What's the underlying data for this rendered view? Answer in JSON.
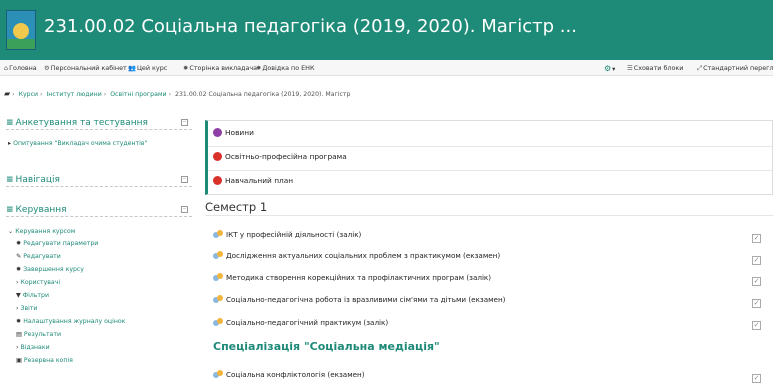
{
  "header": {
    "title": "231.00.02 Соціальна педагогіка (2019, 2020). Магістр ..."
  },
  "navbar": {
    "home": "Головна",
    "cabinet": "Персональний кабінет",
    "course": "Цей курс",
    "teacher_page": "Сторінка викладача",
    "help": "Довідка по ЕНК",
    "hide_blocks": "Сховати блоки",
    "standard_view": "Стандартний перегляд"
  },
  "breadcrumb": {
    "items": [
      "Курси",
      "Інститут людини",
      "Освітні програми"
    ],
    "current": "231.00.02 Соціальна педагогіка (2019, 2020). Магістр"
  },
  "sidebar": {
    "survey": {
      "title": "Анкетування та тестування",
      "link": "Опитування \"Викладач очима студентів\""
    },
    "navigation": {
      "title": "Навігація"
    },
    "management": {
      "title": "Керування",
      "course_admin": "Керування курсом",
      "items": [
        "Редагувати параметри",
        "Редагувати",
        "Завершення курсу",
        "Користувачі",
        "Фільтри",
        "Звіти",
        "Налаштування журналу оцінок",
        "Результати",
        "Відзнаки",
        "Резервна копія"
      ]
    }
  },
  "top_section": {
    "items": [
      "Новини",
      "Освітньо-професійна програма",
      "Навчальний план"
    ]
  },
  "semester": {
    "title": "Семестр 1",
    "activities": [
      "ІКТ у професійній діяльності (залік)",
      "Дослідження актуальних соціальних проблем з практикумом (екзамен)",
      "Методика створення корекційних та профілактичних програм (залік)",
      "Соціально-педагогічна робота із вразливими сім'ями та дітьми (екзамен)",
      "Соціально-педагогічний практикум (залік)"
    ],
    "specialization": "Спеціалізація \"Соціальна медіація\"",
    "spec_activities": [
      "Соціальна конфліктологія (екзамен)"
    ]
  },
  "colors": {
    "brand": "#1e8a78",
    "news_icon": "#8e3fa6",
    "pdf_icon": "#d9322b"
  }
}
